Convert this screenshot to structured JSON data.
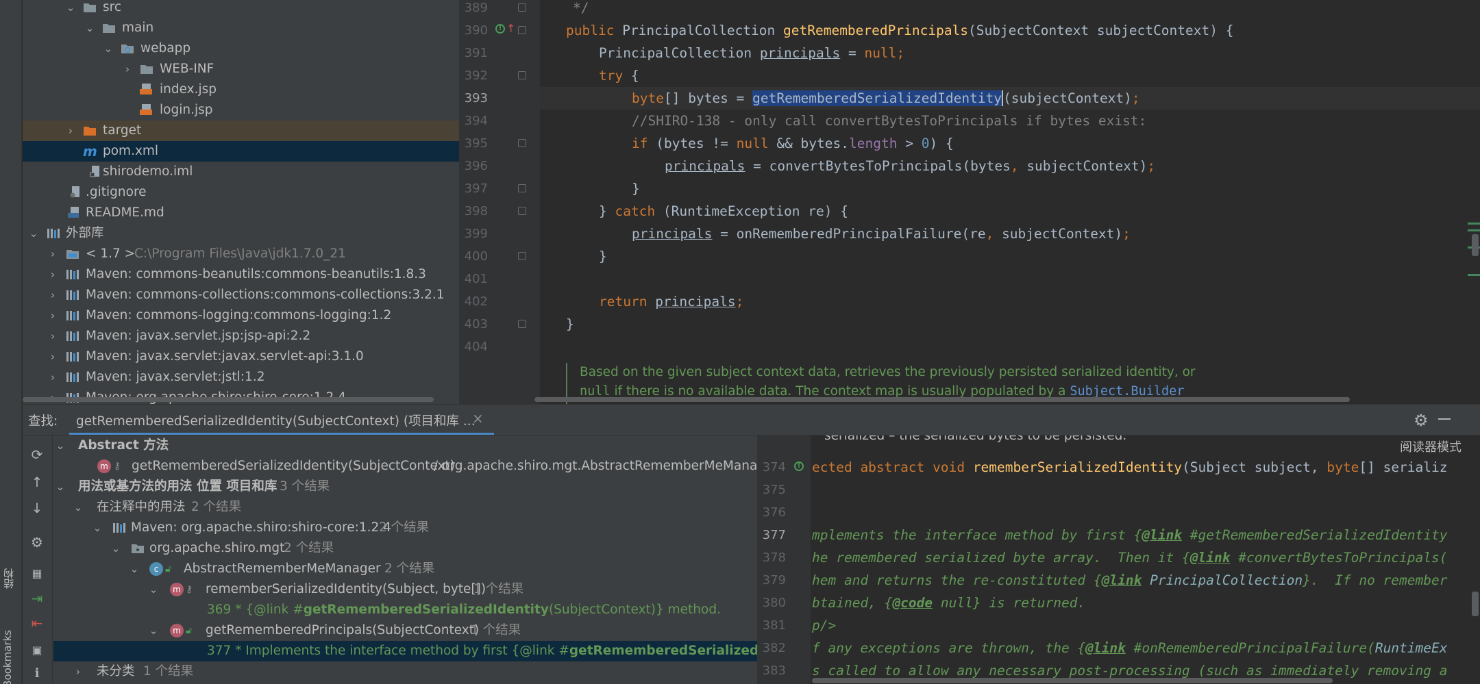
{
  "project_tree": {
    "rows": [
      {
        "label": "src"
      },
      {
        "label": "main"
      },
      {
        "label": "webapp"
      },
      {
        "label": "WEB-INF"
      },
      {
        "label": "index.jsp"
      },
      {
        "label": "login.jsp"
      },
      {
        "label": "target"
      },
      {
        "label": "pom.xml"
      },
      {
        "label": "shirodemo.iml"
      },
      {
        "label": ".gitignore"
      },
      {
        "label": "README.md"
      },
      {
        "label": "外部库"
      },
      {
        "label": "< 1.7 >",
        "extra": "C:\\Program Files\\Java\\jdk1.7.0_21"
      },
      {
        "label": "Maven: commons-beanutils:commons-beanutils:1.8.3"
      },
      {
        "label": "Maven: commons-collections:commons-collections:3.2.1"
      },
      {
        "label": "Maven: commons-logging:commons-logging:1.2"
      },
      {
        "label": "Maven: javax.servlet.jsp:jsp-api:2.2"
      },
      {
        "label": "Maven: javax.servlet:javax.servlet-api:3.1.0"
      },
      {
        "label": "Maven: javax.servlet:jstl:1.2"
      },
      {
        "label": "Maven: org.apache.shiro:shiro-core:1.2.4"
      }
    ]
  },
  "editor": {
    "line_numbers": [
      "389",
      "390",
      "391",
      "392",
      "393",
      "394",
      "395",
      "396",
      "397",
      "398",
      "399",
      "400",
      "401",
      "402",
      "403",
      "404"
    ],
    "current_line": "393",
    "code": {
      "l389": "*/",
      "l390_public": "public",
      "l390_type": "PrincipalCollection",
      "l390_method": "getRememberedPrincipals",
      "l390_params": "(SubjectContext subjectContext) {",
      "l391_type": "PrincipalCollection",
      "l391_var": "principals",
      "l391_eq": " = ",
      "l391_null": "null",
      "l391_end": ";",
      "l392_try": "try",
      "l392_brace": " {",
      "l393_kw": "byte",
      "l393_mid": "[] bytes = ",
      "l393_sel": "getRememberedSerializedIdentity",
      "l393_args": "(subjectContext)",
      "l393_end": ";",
      "l394": "//SHIRO-138 - only call convertBytesToPrincipals if bytes exist:",
      "l395_if": "if",
      "l395_a": " (bytes != ",
      "l395_null": "null",
      "l395_b": " && bytes.",
      "l395_len": "length",
      "l395_c": " > ",
      "l395_zero": "0",
      "l395_d": ") {",
      "l396_var": "principals",
      "l396_a": " = convertBytesToPrincipals(bytes",
      "l396_comma": ",",
      "l396_b": " subjectContext)",
      "l396_end": ";",
      "l397": "}",
      "l398_a": "} ",
      "l398_catch": "catch",
      "l398_b": " (RuntimeException re) {",
      "l399_var": "principals",
      "l399_a": " = onRememberedPrincipalFailure(re",
      "l399_comma": ",",
      "l399_b": " subjectContext)",
      "l399_end": ";",
      "l400": "}",
      "l402_ret": "return",
      "l402_var": "principals",
      "l402_end": ";",
      "l403": "}"
    },
    "doc_line1": "Based on the given subject context data, retrieves the previously persisted serialized identity, or",
    "doc_null": "null",
    "doc_line2": " if there is no available data. The context map is usually populated by a ",
    "doc_link": "Subject.Builder"
  },
  "find": {
    "label": "查找:",
    "tab_title": "getRememberedSerializedIdentity(SubjectContext) (项目和库 ...",
    "close": "×",
    "rows": [
      {
        "text": "Abstract 方法"
      },
      {
        "text": "getRememberedSerializedIdentity(SubjectContext)",
        "extra": " / org.apache.shiro.mgt.AbstractRememberMeManage"
      },
      {
        "text": "用法或基方法的用法 位置 项目和库",
        "count": "3 个结果"
      },
      {
        "text": "在注释中的用法",
        "count": "2 个结果"
      },
      {
        "text": "Maven: org.apache.shiro:shiro-core:1.2.4",
        "count": "2 个结果"
      },
      {
        "text": "org.apache.shiro.mgt",
        "count": "2 个结果"
      },
      {
        "text": "AbstractRememberMeManager",
        "count": "2 个结果"
      },
      {
        "text": "rememberSerializedIdentity(Subject, byte[])",
        "count": "1 个结果"
      },
      {
        "pre": "369 * {@link #",
        "bold": "getRememberedSerializedIdentity",
        "post": "(SubjectContext)} method."
      },
      {
        "text": "getRememberedPrincipals(SubjectContext)",
        "count": "1 个结果"
      },
      {
        "pre": "377 * Implements the interface method by first {@link #",
        "bold": "getRememberedSerializedIdentity",
        "post": "(S"
      },
      {
        "text": "未分类",
        "count": "1 个结果"
      }
    ],
    "side_label": "结构",
    "bookmarks_label": "Bookmarks"
  },
  "preview": {
    "reader_mode": "阅读器模式",
    "top_partial": "serialized – the serialized bytes to be persisted.",
    "line_numbers": [
      "374",
      "375",
      "376",
      "377",
      "378",
      "379",
      "380",
      "381",
      "382",
      "383"
    ],
    "current_line": "377",
    "l374_a": "ected abstract void ",
    "l374_fn": "rememberSerializedIdentity",
    "l374_b": "(Subject subject, ",
    "l374_kw": "byte",
    "l374_c": "[] serializ",
    "l377_a": "mplements the interface method by first {",
    "l377_tag": "@link",
    "l377_ref": " #getRememberedSerializedIdentity",
    "l378_a": "he remembered serialized byte array.  Then it {",
    "l378_tag": "@link",
    "l378_ref": " #convertBytesToPrincipals(",
    "l379_a": "hem and returns the re-constituted {",
    "l379_tag": "@link",
    "l379_ref": " PrincipalCollection",
    "l379_b": "}.  If no remember",
    "l380_a": "btained, {",
    "l380_tag": "@code",
    "l380_b": " null} is returned.",
    "l381": "p/>",
    "l382_a": "f any exceptions are thrown, the {",
    "l382_tag": "@link",
    "l382_ref": " #onRememberedPrincipalFailure(",
    "l382_b": "RuntimeEx",
    "l383": "s called to allow any necessary post-processing (such as immediately removing a"
  },
  "colors": {
    "background": "#2b2b2b",
    "panel": "#3c3f41",
    "keyword": "#cc7832",
    "method": "#ffc66d",
    "comment": "#808080",
    "doc": "#629755",
    "selection": "#214283",
    "tree_selection": "#0d293e"
  }
}
